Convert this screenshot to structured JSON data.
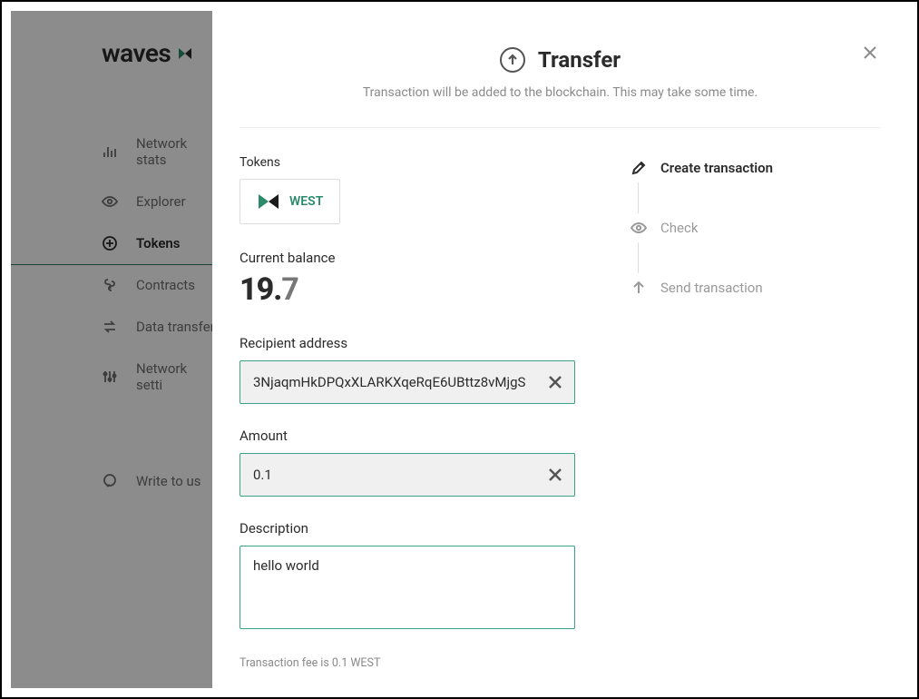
{
  "brand": "waves",
  "sidebar": {
    "items": [
      {
        "label": "Network stats"
      },
      {
        "label": "Explorer"
      },
      {
        "label": "Tokens"
      },
      {
        "label": "Contracts"
      },
      {
        "label": "Data transfer"
      },
      {
        "label": "Network setti"
      }
    ],
    "footer": {
      "label": "Write to us"
    }
  },
  "modal": {
    "title": "Transfer",
    "subtitle": "Transaction will be added to the blockchain. This may take some time.",
    "tokens_label": "Tokens",
    "token_name": "WEST",
    "balance_label": "Current balance",
    "balance_int": "19.",
    "balance_frac": "7",
    "recipient_label": "Recipient address",
    "recipient_value": "3NjaqmHkDPQxXLARKXqeRqE6UBttz8vMjgS",
    "amount_label": "Amount",
    "amount_value": "0.1",
    "description_label": "Description",
    "description_value": "hello world",
    "fee_text": "Transaction fee is 0.1 WEST",
    "steps": [
      {
        "label": "Create transaction"
      },
      {
        "label": "Check"
      },
      {
        "label": "Send transaction"
      }
    ]
  }
}
